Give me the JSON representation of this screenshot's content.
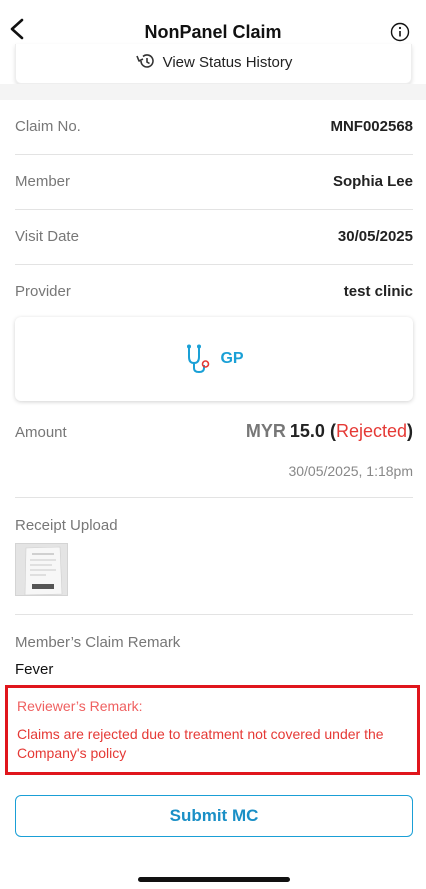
{
  "header": {
    "title": "NonPanel Claim",
    "back_icon": "chevron-left-icon",
    "info_icon": "info-circle-icon"
  },
  "status_history": {
    "label": "View Status History",
    "icon": "history-icon"
  },
  "details": [
    {
      "label": "Claim No.",
      "value": "MNF002568"
    },
    {
      "label": "Member",
      "value": "Sophia Lee"
    },
    {
      "label": "Visit Date",
      "value": "30/05/2025"
    },
    {
      "label": "Provider",
      "value": "test clinic"
    }
  ],
  "service": {
    "label": "GP",
    "icon": "stethoscope-icon",
    "color": "#1aa0d6"
  },
  "amount": {
    "label": "Amount",
    "currency": "MYR",
    "value": "15.0",
    "open_paren": " (",
    "status": "Rejected",
    "close_paren": ")",
    "status_color": "#e53935",
    "datetime": "30/05/2025, 1:18pm"
  },
  "receipt": {
    "label": "Receipt Upload"
  },
  "member_remark": {
    "label": "Member’s Claim Remark",
    "value": "Fever"
  },
  "reviewer_remark": {
    "label": "Reviewer’s Remark:",
    "value": "Claims are rejected due to treatment not covered under the Company's policy",
    "highlight_color": "#e0161c"
  },
  "submit_button": {
    "label": "Submit MC",
    "color": "#1a9fd6"
  }
}
